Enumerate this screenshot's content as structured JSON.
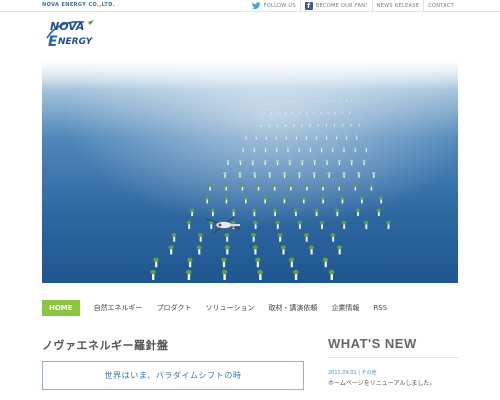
{
  "header": {
    "company_name": "NOVA ENERGY CO.,LTD.",
    "links": [
      {
        "label": "FOLLOW US",
        "icon": "twitter-bird-icon"
      },
      {
        "label": "BECOME OUR FAN!",
        "icon": "facebook-icon"
      },
      {
        "label": "NEWS RELEASE"
      },
      {
        "label": "CONTACT"
      }
    ]
  },
  "logo": {
    "line1": "NOVA",
    "line2": "NERGY",
    "letter": "E"
  },
  "hero": {
    "icon": "ocean-floating-power-array-image"
  },
  "nav": {
    "items": [
      "HOME",
      "自然エネルギー",
      "プロダクト",
      "ソリューション",
      "取材・講演依頼",
      "企業情報",
      "RSS"
    ],
    "active_index": 0
  },
  "main": {
    "title": "ノヴァエネルギー羅針盤",
    "banner_text": "世界はいま、パラダイムシフトの時"
  },
  "news": {
    "title": "WHAT'S NEW",
    "items": [
      {
        "date": "2011.09.01 | その他",
        "text": "ホームページをリニューアルしました。"
      }
    ]
  },
  "colors": {
    "accent_green": "#8cc63f",
    "brand_blue": "#3b73b0",
    "sea": "#2f6fa8"
  }
}
